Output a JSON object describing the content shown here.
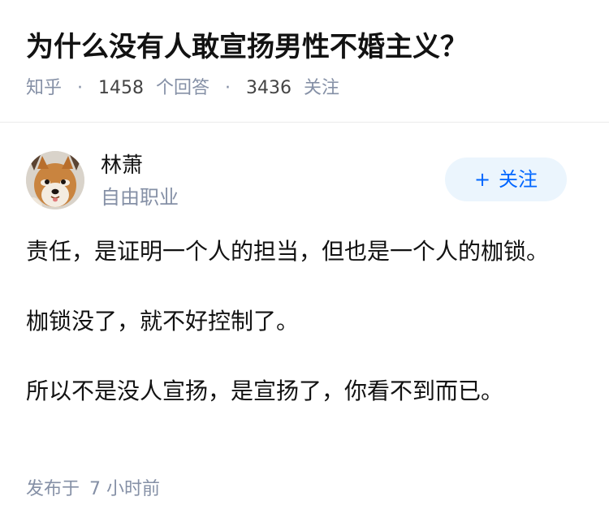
{
  "question": {
    "title": "为什么没有人敢宣扬男性不婚主义？",
    "source": "知乎",
    "answer_count": "1458",
    "answer_label": "个回答",
    "follower_count": "3436",
    "follower_label": "关注"
  },
  "author": {
    "name": "林萧",
    "bio": "自由职业",
    "avatar_icon": "shiba-dog-avatar",
    "follow_plus": "+",
    "follow_label": "关注"
  },
  "answer": {
    "paragraphs": [
      "责任，是证明一个人的担当，但也是一个人的枷锁。",
      "枷锁没了，就不好控制了。",
      "所以不是没人宣扬，是宣扬了，你看不到而已。"
    ],
    "publish_prefix": "发布于",
    "publish_time": "7 小时前"
  },
  "colors": {
    "text_primary": "#121212",
    "text_secondary": "#8590a6",
    "accent": "#0066ff",
    "follow_bg": "#ebf5fd"
  }
}
